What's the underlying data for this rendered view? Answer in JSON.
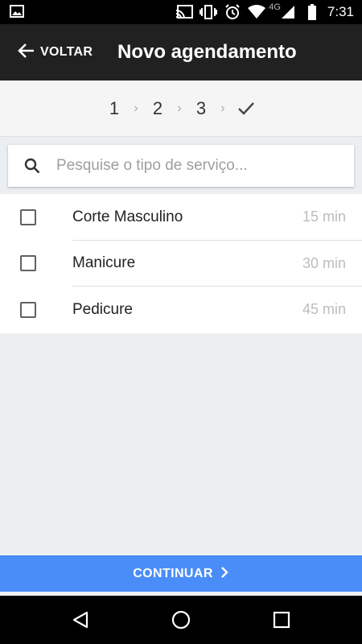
{
  "status_bar": {
    "network_label": "4G",
    "time": "7:31",
    "icons": [
      "image-icon",
      "cast-icon",
      "vibrate-icon",
      "alarm-icon",
      "wifi-icon",
      "signal-icon",
      "battery-icon"
    ]
  },
  "app_bar": {
    "back_label": "VOLTAR",
    "title": "Novo agendamento"
  },
  "stepper": {
    "steps": [
      "1",
      "2",
      "3"
    ],
    "separator": "›",
    "final_icon": "check-icon"
  },
  "search": {
    "placeholder": "Pesquise o tipo de serviço..."
  },
  "services": [
    {
      "name": "Corte Masculino",
      "duration": "15 min",
      "checked": false
    },
    {
      "name": "Manicure",
      "duration": "30 min",
      "checked": false
    },
    {
      "name": "Pedicure",
      "duration": "45 min",
      "checked": false
    }
  ],
  "continue_button": {
    "label": "CONTINUAR",
    "icon": "chevron-right-icon"
  },
  "nav_bar": {
    "buttons": [
      "back-icon",
      "home-icon",
      "recents-icon"
    ]
  },
  "colors": {
    "app_bar": "#212121",
    "accent": "#4a8df8",
    "background": "#eceff1"
  }
}
